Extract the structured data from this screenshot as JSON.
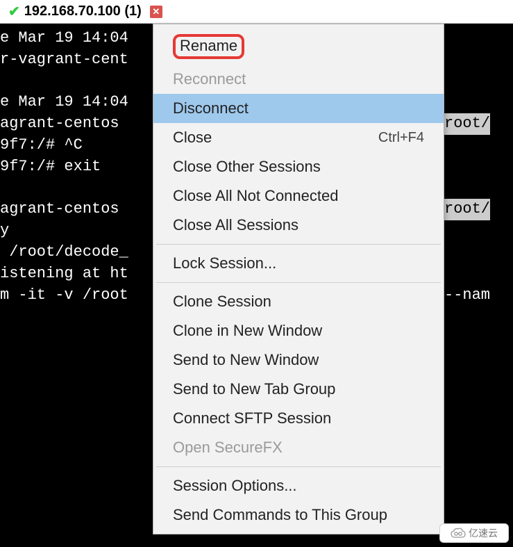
{
  "tab": {
    "title": "192.168.70.100 (1)",
    "status_icon": "connected-check",
    "close_icon": "close-icon"
  },
  "terminal": {
    "lines": [
      "e Mar 19 14:04",
      "r-vagrant-cent",
      "",
      "e Mar 19 14:04",
      "agrant-centos ",
      "9f7:/# ^C",
      "9f7:/# exit",
      "",
      "agrant-centos ",
      "y",
      " /root/decode_",
      "istening at ht",
      "m -it -v /root"
    ],
    "right_fragments": {
      "4": "root/",
      "8": "root/",
      "12": "--nam"
    }
  },
  "menu": {
    "items": [
      {
        "label": "Rename",
        "disabled": false,
        "highlighted": true
      },
      {
        "label": "Reconnect",
        "disabled": true
      },
      {
        "label": "Disconnect",
        "disabled": false,
        "hover": true
      },
      {
        "label": "Close",
        "disabled": false,
        "shortcut": "Ctrl+F4"
      },
      {
        "label": "Close Other Sessions",
        "disabled": false
      },
      {
        "label": "Close All Not Connected",
        "disabled": false
      },
      {
        "label": "Close All Sessions",
        "disabled": false
      },
      {
        "sep": true
      },
      {
        "label": "Lock Session...",
        "disabled": false
      },
      {
        "sep": true
      },
      {
        "label": "Clone Session",
        "disabled": false
      },
      {
        "label": "Clone in New Window",
        "disabled": false
      },
      {
        "label": "Send to New Window",
        "disabled": false
      },
      {
        "label": "Send to New Tab Group",
        "disabled": false
      },
      {
        "label": "Connect SFTP Session",
        "disabled": false
      },
      {
        "label": "Open SecureFX",
        "disabled": true
      },
      {
        "sep": true
      },
      {
        "label": "Session Options...",
        "disabled": false
      },
      {
        "label": "Send Commands to This Group",
        "disabled": false
      }
    ]
  },
  "watermark": {
    "text": "亿速云",
    "icon": "cloud-link-icon"
  }
}
